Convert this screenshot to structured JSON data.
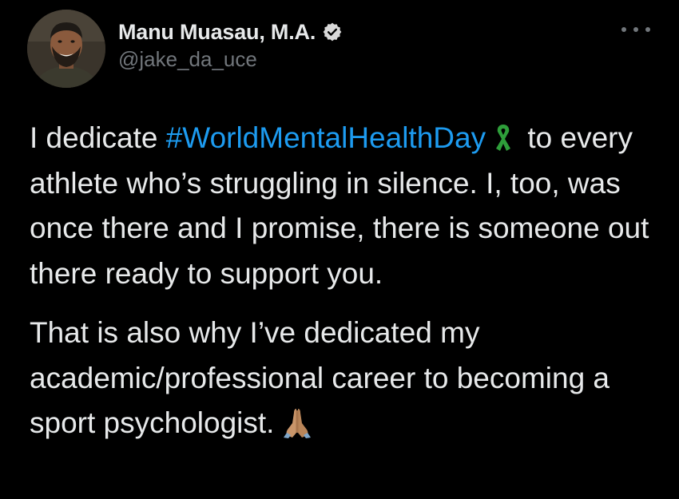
{
  "author": {
    "display_name": "Manu Muasau, M.A.",
    "handle": "@jake_da_uce",
    "verified": true,
    "avatar_icon": "profile-photo"
  },
  "menu": {
    "icon": "more-horizontal-icon"
  },
  "tweet": {
    "paragraph1": {
      "before": "I dedicate ",
      "hashtag": "#WorldMentalHealthDay",
      "emoji_icon": "green-ribbon-icon",
      "after_emoji": " to every athlete who’s struggling in silence. I, too, was once there and I promise, there is someone out there ready to support you."
    },
    "paragraph2": {
      "text": "That is also why I’ve dedicated my academic/professional career to becoming a sport psychologist.",
      "emoji_icon": "folded-hands-icon"
    }
  },
  "colors": {
    "background": "#000000",
    "text": "#e7e9ea",
    "secondary": "#71767b",
    "link": "#1d9bf0",
    "ribbon": "#2e9e3a"
  }
}
